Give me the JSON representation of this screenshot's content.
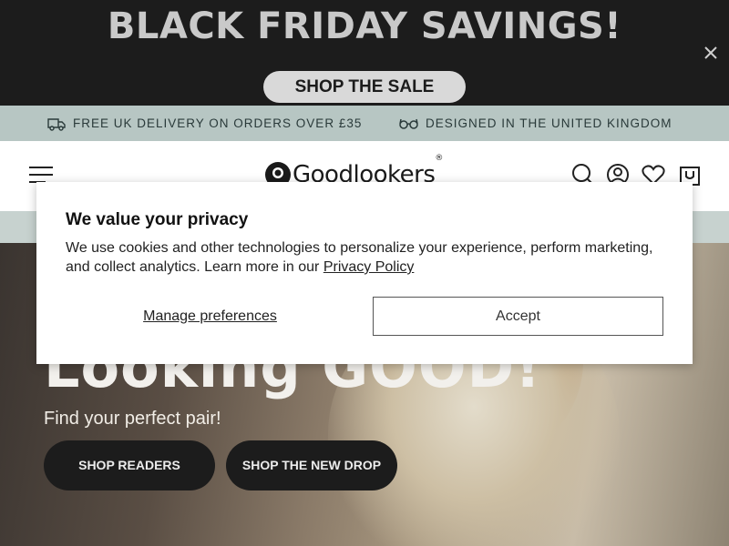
{
  "promo": {
    "title": "BLACK FRIDAY SAVINGS!",
    "cta_label": "SHOP THE SALE",
    "close_icon": "close-icon"
  },
  "usp": {
    "items": [
      {
        "icon": "delivery-truck-icon",
        "label": "FREE UK DELIVERY ON ORDERS OVER £35"
      },
      {
        "icon": "glasses-icon",
        "label": "DESIGNED IN THE UNITED KINGDOM"
      }
    ]
  },
  "header": {
    "logo_text": "Goodlookers",
    "logo_reg": "®",
    "icons": [
      "menu-icon",
      "search-icon",
      "account-icon",
      "wishlist-heart-icon",
      "cart-bag-icon"
    ]
  },
  "hero": {
    "heading": "Looking GOOD!",
    "subheading": "Find your perfect pair!",
    "buttons": [
      "SHOP READERS",
      "SHOP THE NEW DROP"
    ]
  },
  "cookie_modal": {
    "title": "We value your privacy",
    "body": "We use cookies and other technologies to personalize your experience, perform marketing, and collect analytics. Learn more in our ",
    "link_label": "Privacy Policy",
    "manage_label": "Manage preferences",
    "accept_label": "Accept"
  }
}
